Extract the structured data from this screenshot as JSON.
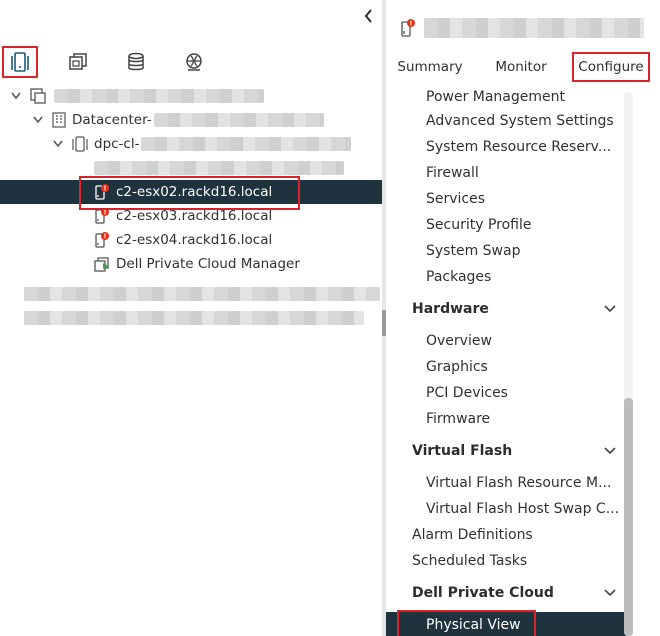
{
  "colors": {
    "highlight": "#d8232a",
    "selected_bg": "#1f333f",
    "alert": "#e1331a",
    "vm_green": "#3ea64a"
  },
  "left_nav": {
    "icons": [
      "hosts-and-clusters-icon",
      "vms-and-templates-icon",
      "storage-icon",
      "networking-icon"
    ]
  },
  "tree": {
    "datacenter_prefix": "Datacenter-",
    "cluster_prefix": "dpc-cl-",
    "hosts": [
      "c2-esx02.rackd16.local",
      "c2-esx03.rackd16.local",
      "c2-esx04.rackd16.local"
    ],
    "manager": "Dell Private Cloud Manager"
  },
  "tabs": [
    "Summary",
    "Monitor",
    "Configure"
  ],
  "menu": {
    "system_items": [
      "Power Management",
      "Advanced System Settings",
      "System Resource Reserv...",
      "Firewall",
      "Services",
      "Security Profile",
      "System Swap",
      "Packages"
    ],
    "hardware_label": "Hardware",
    "hardware_items": [
      "Overview",
      "Graphics",
      "PCI Devices",
      "Firmware"
    ],
    "virtual_flash_label": "Virtual Flash",
    "virtual_flash_items": [
      "Virtual Flash Resource M...",
      "Virtual Flash Host Swap C..."
    ],
    "alarm_definitions": "Alarm Definitions",
    "scheduled_tasks": "Scheduled Tasks",
    "dpc_label": "Dell Private Cloud",
    "physical_view": "Physical View"
  }
}
